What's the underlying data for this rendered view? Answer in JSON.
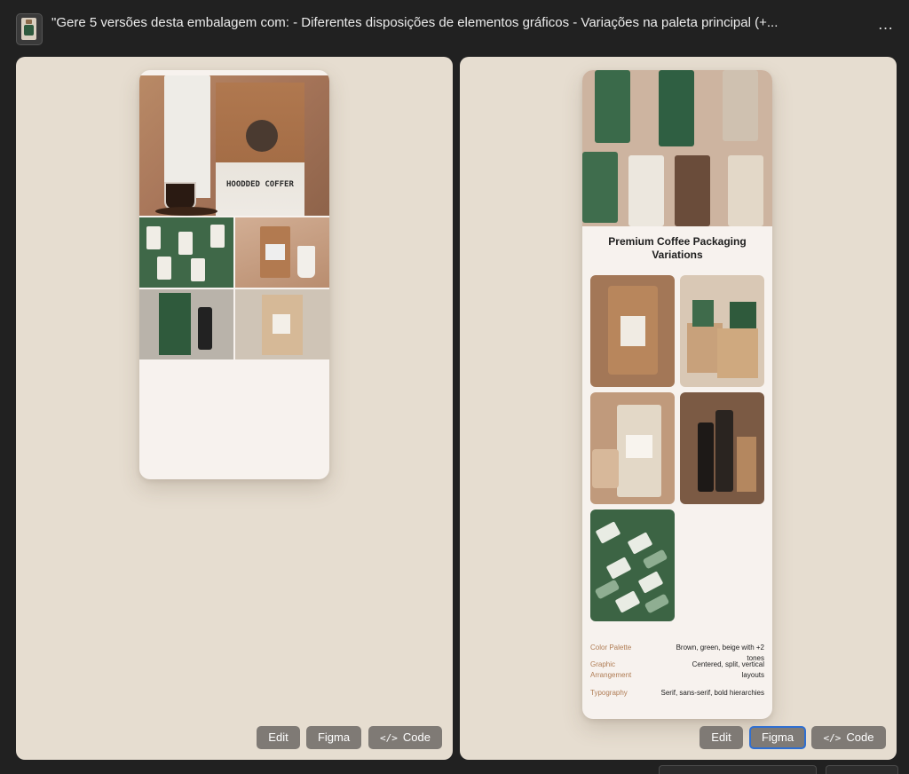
{
  "header": {
    "prompt": "\"Gere 5 versões desta embalagem com:  - Diferentes disposições de elementos gráficos  - Variações na paleta principal (+...",
    "more_label": "…"
  },
  "left_card": {
    "hero_word": "HOODDED COFFER",
    "buttons": {
      "edit": "Edit",
      "figma": "Figma",
      "code": "Code"
    }
  },
  "right_card": {
    "title": "Premium Coffee Packaging Variations",
    "specs": [
      {
        "label": "Color Palette",
        "value": "Brown, green, beige with +2 tones"
      },
      {
        "label": "Graphic Arrangement",
        "value": "Centered, split, vertical layouts"
      },
      {
        "label": "Typography",
        "value": "Serif, sans-serif, bold hierarchies"
      }
    ],
    "buttons": {
      "edit": "Edit",
      "figma": "Figma",
      "code": "Code"
    }
  },
  "icons": {
    "code": "code-icon",
    "more": "more-icon"
  },
  "colors": {
    "background": "#212121",
    "panel": "#e6ddd0",
    "button": "#7f7a75",
    "focus_ring": "#2f6fd1",
    "spec_label": "#b07d55"
  }
}
